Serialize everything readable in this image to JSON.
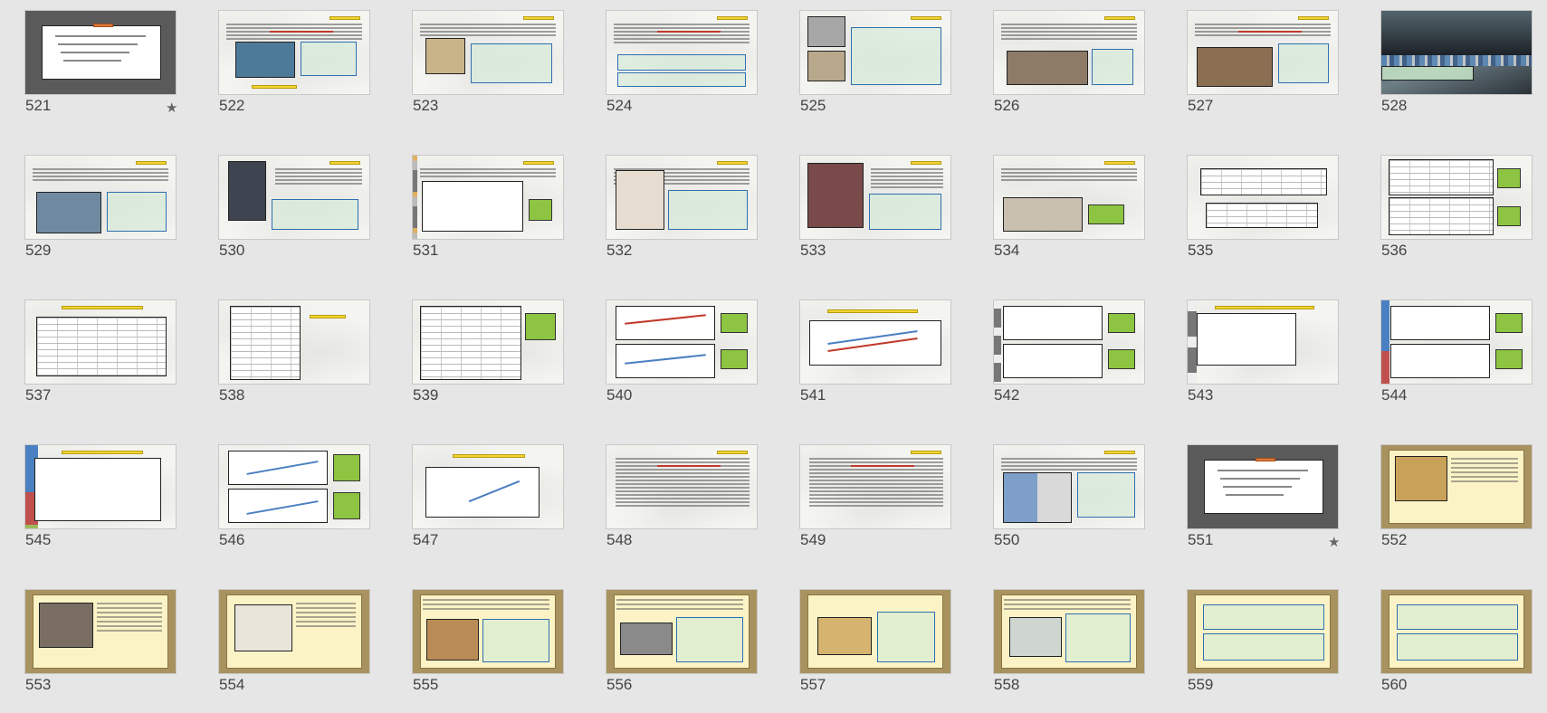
{
  "slides": [
    {
      "n": "521",
      "style": "gray",
      "starred": true
    },
    {
      "n": "522",
      "style": "paper"
    },
    {
      "n": "523",
      "style": "paper"
    },
    {
      "n": "524",
      "style": "paper"
    },
    {
      "n": "525",
      "style": "paper"
    },
    {
      "n": "526",
      "style": "paper"
    },
    {
      "n": "527",
      "style": "paper"
    },
    {
      "n": "528",
      "style": "photo"
    },
    {
      "n": "529",
      "style": "paper"
    },
    {
      "n": "530",
      "style": "paper"
    },
    {
      "n": "531",
      "style": "paper"
    },
    {
      "n": "532",
      "style": "paper"
    },
    {
      "n": "533",
      "style": "paper"
    },
    {
      "n": "534",
      "style": "paper"
    },
    {
      "n": "535",
      "style": "paper"
    },
    {
      "n": "536",
      "style": "paper"
    },
    {
      "n": "537",
      "style": "paper"
    },
    {
      "n": "538",
      "style": "paper"
    },
    {
      "n": "539",
      "style": "paper"
    },
    {
      "n": "540",
      "style": "paper"
    },
    {
      "n": "541",
      "style": "paper"
    },
    {
      "n": "542",
      "style": "paper"
    },
    {
      "n": "543",
      "style": "paper"
    },
    {
      "n": "544",
      "style": "paper"
    },
    {
      "n": "545",
      "style": "paper"
    },
    {
      "n": "546",
      "style": "paper"
    },
    {
      "n": "547",
      "style": "paper"
    },
    {
      "n": "548",
      "style": "paper"
    },
    {
      "n": "549",
      "style": "paper"
    },
    {
      "n": "550",
      "style": "paper"
    },
    {
      "n": "551",
      "style": "gray",
      "starred": true
    },
    {
      "n": "552",
      "style": "cream"
    },
    {
      "n": "553",
      "style": "cream"
    },
    {
      "n": "554",
      "style": "cream"
    },
    {
      "n": "555",
      "style": "cream"
    },
    {
      "n": "556",
      "style": "cream"
    },
    {
      "n": "557",
      "style": "cream"
    },
    {
      "n": "558",
      "style": "cream"
    },
    {
      "n": "559",
      "style": "cream"
    },
    {
      "n": "560",
      "style": "cream"
    }
  ],
  "star_glyph": "★",
  "colors": {
    "background": "#e6e6e6",
    "title_bar": "#f2d531",
    "green_label": "#8dc441",
    "bar_blue": "#4a7fc1",
    "bar_red": "#c0504d",
    "bar_green": "#9bbb59",
    "cream_frame": "#fbf3c6"
  }
}
